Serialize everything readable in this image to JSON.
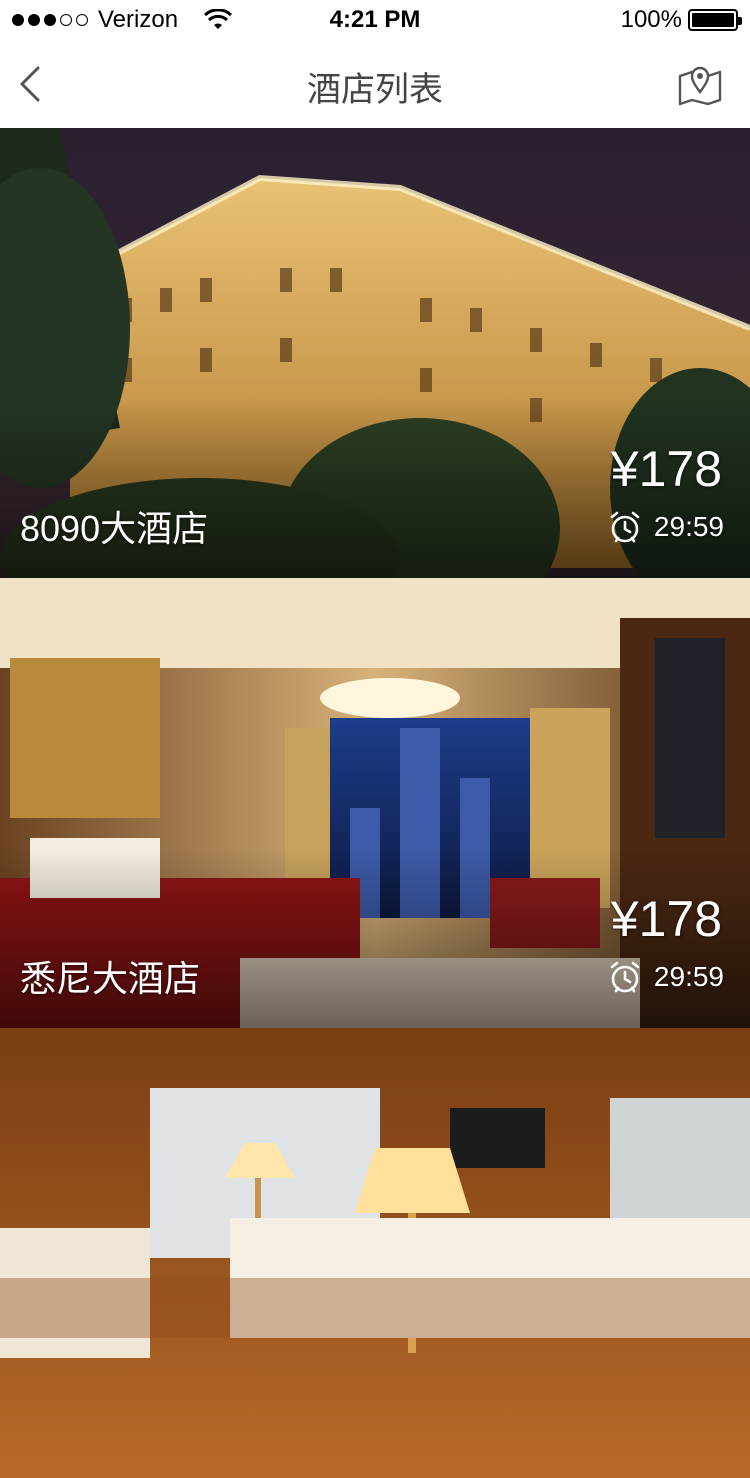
{
  "status_bar": {
    "carrier": "Verizon",
    "time": "4:21 PM",
    "battery": "100%",
    "signal_filled": 3,
    "signal_total": 5
  },
  "nav": {
    "title": "酒店列表",
    "back_icon": "chevron-left-icon",
    "map_icon": "map-pin-icon"
  },
  "hotels": [
    {
      "name": "8090大酒店",
      "price": "¥178",
      "countdown": "29:59",
      "scene": "night-exterior"
    },
    {
      "name": "悉尼大酒店",
      "price": "¥178",
      "countdown": "29:59",
      "scene": "bedroom-city-view"
    },
    {
      "name": "",
      "price": "",
      "countdown": "",
      "scene": "wood-bedroom"
    }
  ]
}
